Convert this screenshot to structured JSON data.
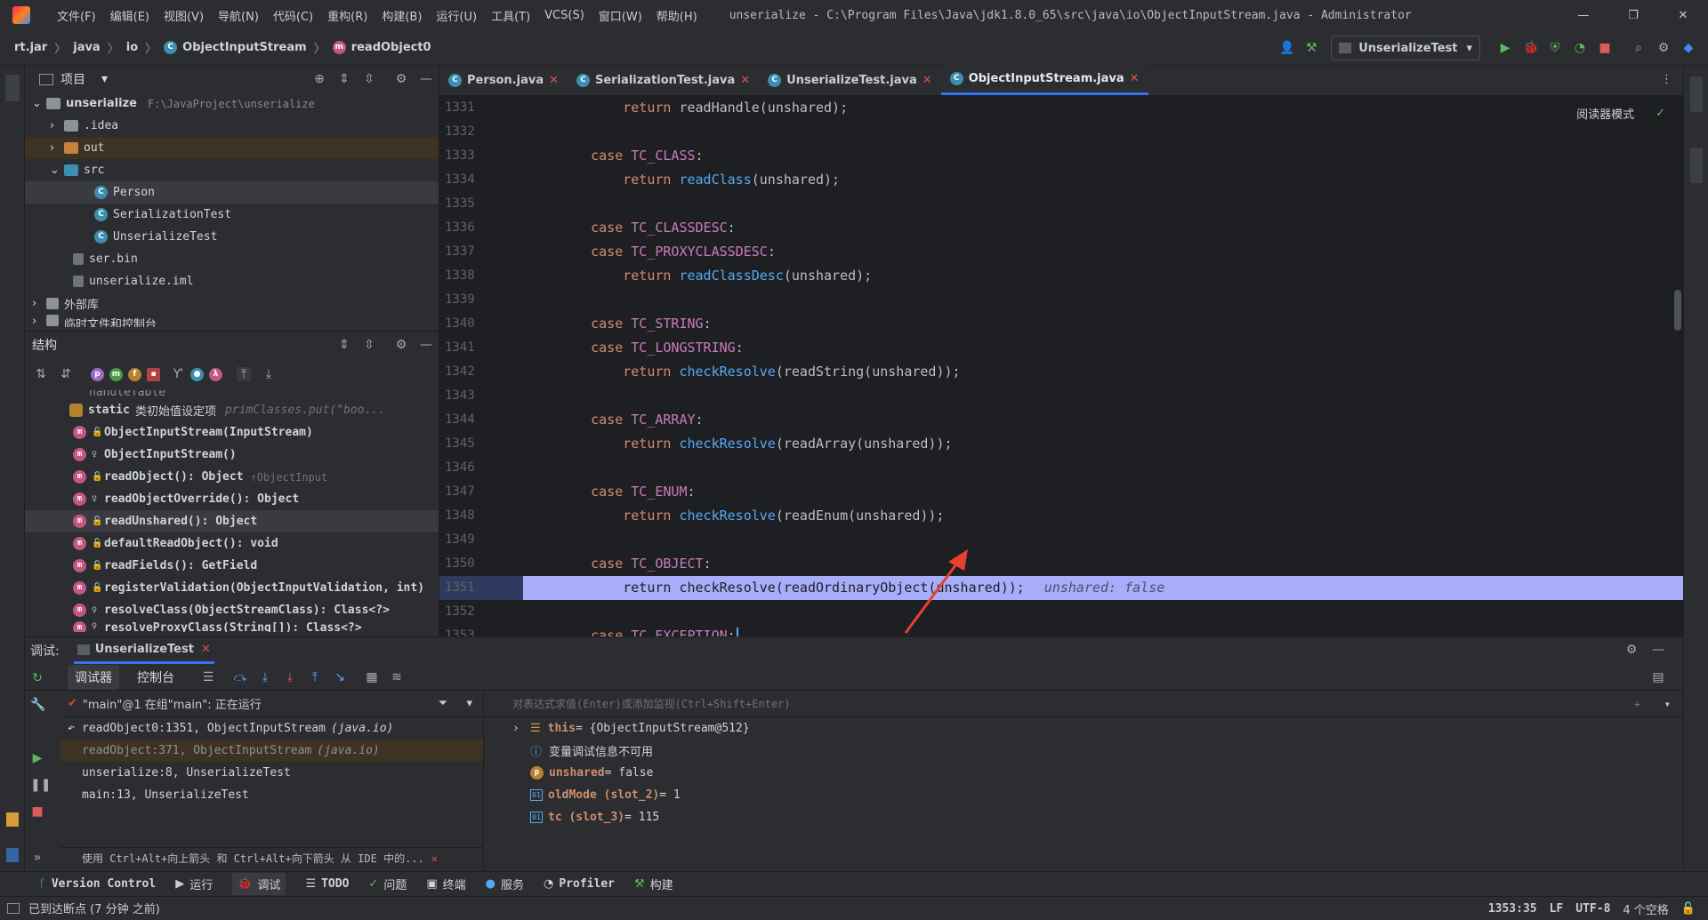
{
  "titlebar": {
    "menu": [
      "文件(F)",
      "编辑(E)",
      "视图(V)",
      "导航(N)",
      "代码(C)",
      "重构(R)",
      "构建(B)",
      "运行(U)",
      "工具(T)",
      "VCS(S)",
      "窗口(W)",
      "帮助(H)"
    ],
    "window_title": "unserialize - C:\\Program Files\\Java\\jdk1.8.0_65\\src\\java\\io\\ObjectInputStream.java - Administrator"
  },
  "breadcrumb": [
    "rt.jar",
    "java",
    "io",
    "ObjectInputStream",
    "readObject0"
  ],
  "run_config": "UnserializeTest",
  "project": {
    "title": "项目",
    "root": {
      "name": "unserialize",
      "path": "F:\\JavaProject\\unserialize"
    },
    "items": [
      ".idea",
      "out",
      "src",
      "Person",
      "SerializationTest",
      "UnserializeTest",
      "ser.bin",
      "unserialize.iml",
      "外部库",
      "临时文件和控制台"
    ]
  },
  "structure": {
    "title": "结构",
    "partial_top": "handleTable",
    "static_item": {
      "kw": "static",
      "label": "类初始值设定项",
      "hint": "primClasses.put(\"boo..."
    },
    "items": [
      "ObjectInputStream(InputStream)",
      "ObjectInputStream()",
      "readObject(): Object",
      "readObjectOverride(): Object",
      "readUnshared(): Object",
      "defaultReadObject(): void",
      "readFields(): GetField",
      "registerValidation(ObjectInputValidation, int)",
      "resolveClass(ObjectStreamClass): Class<?>",
      "resolveProxyClass(String[]): Class<?>"
    ],
    "readObject_hint": "↑ObjectInput"
  },
  "tabs": [
    {
      "label": "Person.java"
    },
    {
      "label": "SerializationTest.java"
    },
    {
      "label": "UnserializeTest.java"
    },
    {
      "label": "ObjectInputStream.java"
    }
  ],
  "reader_mode": "阅读器模式",
  "code": {
    "line_numbers": [
      "1331",
      "1332",
      "1333",
      "1334",
      "1335",
      "1336",
      "1337",
      "1338",
      "1339",
      "1340",
      "1341",
      "1342",
      "1343",
      "1344",
      "1345",
      "1346",
      "1347",
      "1348",
      "1349",
      "1350",
      "1351",
      "1352",
      "1353"
    ],
    "lines": [
      {
        "indent": "        ",
        "kw": "return",
        "rest": " readHandle(unshared);"
      },
      {
        "indent": "",
        "kw": "",
        "rest": ""
      },
      {
        "indent": "    ",
        "kw": "case",
        "cn": "TC_CLASS",
        "rest": ":"
      },
      {
        "indent": "        ",
        "kw": "return",
        "fn": "readClass",
        "rest": "(unshared);"
      },
      {
        "indent": "",
        "kw": "",
        "rest": ""
      },
      {
        "indent": "    ",
        "kw": "case",
        "cn": "TC_CLASSDESC",
        "rest": ":"
      },
      {
        "indent": "    ",
        "kw": "case",
        "cn": "TC_PROXYCLASSDESC",
        "rest": ":"
      },
      {
        "indent": "        ",
        "kw": "return",
        "fn": "readClassDesc",
        "rest": "(unshared);"
      },
      {
        "indent": "",
        "kw": "",
        "rest": ""
      },
      {
        "indent": "    ",
        "kw": "case",
        "cn": "TC_STRING",
        "rest": ":"
      },
      {
        "indent": "    ",
        "kw": "case",
        "cn": "TC_LONGSTRING",
        "rest": ":"
      },
      {
        "indent": "        ",
        "kw": "return",
        "fn": "checkResolve",
        "rest": "(readString(unshared));"
      },
      {
        "indent": "",
        "kw": "",
        "rest": ""
      },
      {
        "indent": "    ",
        "kw": "case",
        "cn": "TC_ARRAY",
        "rest": ":"
      },
      {
        "indent": "        ",
        "kw": "return",
        "fn": "checkResolve",
        "rest": "(readArray(unshared));"
      },
      {
        "indent": "",
        "kw": "",
        "rest": ""
      },
      {
        "indent": "    ",
        "kw": "case",
        "cn": "TC_ENUM",
        "rest": ":"
      },
      {
        "indent": "        ",
        "kw": "return",
        "fn": "checkResolve",
        "rest": "(readEnum(unshared));"
      },
      {
        "indent": "",
        "kw": "",
        "rest": ""
      },
      {
        "indent": "    ",
        "kw": "case",
        "cn": "TC_OBJECT",
        "rest": ":"
      },
      {
        "indent": "        ",
        "kw": "return",
        "rest": " checkResolve(readOrdinaryObject(unshared));",
        "hint": "unshared: false",
        "highlight": true
      },
      {
        "indent": "",
        "kw": "",
        "rest": ""
      },
      {
        "indent": "    ",
        "kw": "case",
        "cn": "TC_EXCEPTION",
        "rest": ":"
      }
    ]
  },
  "debug": {
    "label": "调试:",
    "session": "UnserializeTest",
    "subtabs": [
      "调试器",
      "控制台"
    ],
    "thread": "\"main\"@1 在组\"main\": 正在运行",
    "eval_placeholder": "对表达式求值(Enter)或添加监视(Ctrl+Shift+Enter)",
    "frames": [
      {
        "text": "readObject0:1351, ObjectInputStream",
        "pkg": "(java.io)"
      },
      {
        "text": "readObject:371, ObjectInputStream",
        "pkg": "(java.io)"
      },
      {
        "text": "unserialize:8, UnserializeTest",
        "pkg": ""
      },
      {
        "text": "main:13, UnserializeTest",
        "pkg": ""
      }
    ],
    "hint": "使用 Ctrl+Alt+向上箭头 和 Ctrl+Alt+向下箭头 从 IDE 中的...",
    "vars": [
      {
        "name": "this",
        "value": " = {ObjectInputStream@512}"
      },
      {
        "name": "",
        "value": "变量调试信息不可用"
      },
      {
        "name": "unshared",
        "value": " = false"
      },
      {
        "name": "oldMode (slot_2)",
        "value": " = 1"
      },
      {
        "name": "tc (slot_3)",
        "value": " = 115"
      }
    ]
  },
  "bottombar": [
    "Version Control",
    "运行",
    "调试",
    "TODO",
    "问题",
    "终端",
    "服务",
    "Profiler",
    "构建"
  ],
  "status": {
    "message": "已到达断点 (7 分钟 之前)",
    "position": "1353:35",
    "line_sep": "LF",
    "encoding": "UTF-8",
    "indent": "4 个空格"
  }
}
